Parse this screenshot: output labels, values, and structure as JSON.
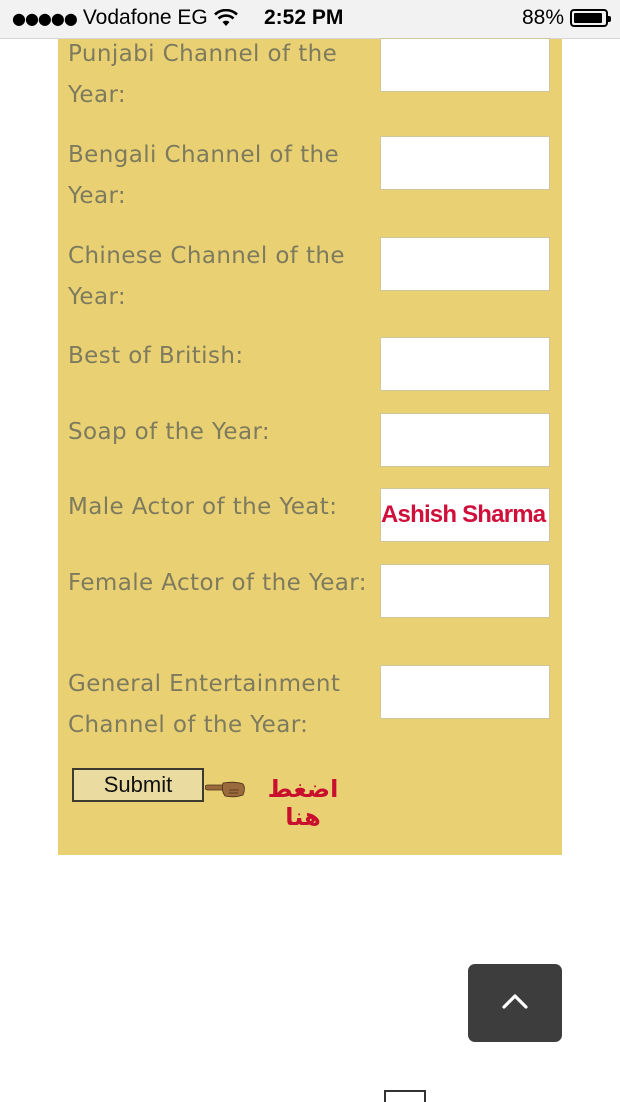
{
  "status_bar": {
    "signal": "●●●●●",
    "carrier": "Vodafone EG",
    "time": "2:52 PM",
    "battery": "88%"
  },
  "form": {
    "fields": [
      {
        "label": "Punjabi Channel of the Year:",
        "value": ""
      },
      {
        "label": "Bengali Channel of the Year:",
        "value": ""
      },
      {
        "label": "Chinese Channel of the Year:",
        "value": ""
      },
      {
        "label": "Best of British:",
        "value": ""
      },
      {
        "label": "Soap of the Year:",
        "value": ""
      },
      {
        "label": "Male Actor of the Yeat:",
        "value": "Ashish Sharma"
      },
      {
        "label": "Female Actor of the Year:",
        "value": ""
      },
      {
        "label": "General Entertainment Channel of the Year:",
        "value": ""
      }
    ],
    "submit_label": "Submit",
    "annotation_text": "اضغط هنا"
  },
  "colors": {
    "panel": "#e9d173",
    "label_text": "#7d7a5e",
    "annotation": "#d0103a",
    "back_to_top": "#3d3d3d"
  },
  "icons": {
    "wifi": "wifi-icon",
    "battery": "battery-icon",
    "hand": "pointing-hand-icon",
    "back_to_top": "chevron-up-icon"
  }
}
